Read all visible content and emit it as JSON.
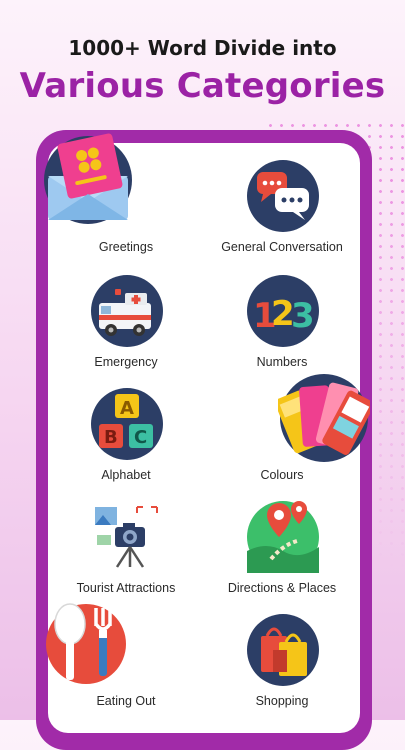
{
  "header": {
    "line1": "1000+ Word Divide into",
    "line2": "Various Categories"
  },
  "categories": [
    {
      "label": "Greetings",
      "icon": "envelope-card-icon"
    },
    {
      "label": "General Conversation",
      "icon": "chat-bubbles-icon"
    },
    {
      "label": "Emergency",
      "icon": "ambulance-icon"
    },
    {
      "label": "Numbers",
      "icon": "numbers-123-icon"
    },
    {
      "label": "Alphabet",
      "icon": "abc-blocks-icon"
    },
    {
      "label": "Colours",
      "icon": "color-swatches-icon"
    },
    {
      "label": "Tourist Attractions",
      "icon": "camera-tripod-icon"
    },
    {
      "label": "Directions & Places",
      "icon": "map-pins-icon"
    },
    {
      "label": "Eating Out",
      "icon": "spoon-fork-icon"
    },
    {
      "label": "Shopping",
      "icon": "shopping-bags-icon"
    }
  ],
  "colors": {
    "accent": "#9b22a5",
    "frame": "#a12ba8",
    "icon_bg": "#2c3e66"
  }
}
